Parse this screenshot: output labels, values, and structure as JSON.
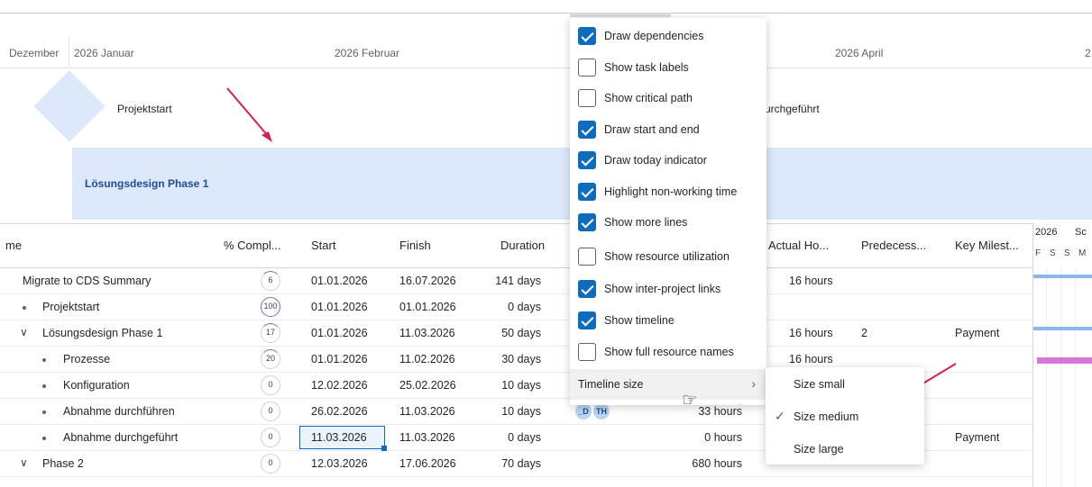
{
  "timeline": {
    "months": [
      "Dezember",
      "2026 Januar",
      "2026 Februar",
      "2026 April",
      "2"
    ],
    "milestone1": "Projektstart",
    "milestone2_partial": "urchgeführt",
    "phase": "Lösungsdesign Phase 1"
  },
  "grid": {
    "headers": {
      "name": "me",
      "pct": "% Compl...",
      "start": "Start",
      "finish": "Finish",
      "duration": "Duration",
      "actual": "Actual Ho...",
      "pred": "Predecess...",
      "key": "Key Milest..."
    },
    "rows": [
      {
        "name": "Migrate to CDS Summary",
        "pct": "6",
        "start": "01.01.2026",
        "finish": "16.07.2026",
        "duration": "141 days",
        "actual": "16 hours",
        "pred": "",
        "key": ""
      },
      {
        "name": "Projektstart",
        "pct": "100",
        "start": "01.01.2026",
        "finish": "01.01.2026",
        "duration": "0 days",
        "actual": "",
        "pred": "",
        "key": ""
      },
      {
        "name": "Lösungsdesign Phase 1",
        "pct": "17",
        "start": "01.01.2026",
        "finish": "11.03.2026",
        "duration": "50 days",
        "actual": "16 hours",
        "pred": "2",
        "key": "Payment"
      },
      {
        "name": "Prozesse",
        "pct": "20",
        "start": "01.01.2026",
        "finish": "11.02.2026",
        "duration": "30 days",
        "actual": "16 hours",
        "pred": "",
        "key": ""
      },
      {
        "name": "Konfiguration",
        "pct": "0",
        "start": "12.02.2026",
        "finish": "25.02.2026",
        "duration": "10 days",
        "actual": "",
        "pred": "",
        "key": ""
      },
      {
        "name": "Abnahme durchführen",
        "pct": "0",
        "start": "26.02.2026",
        "finish": "11.03.2026",
        "duration": "10 days",
        "actual": "33 hours",
        "pred": "",
        "key": ""
      },
      {
        "name": "Abnahme durchgeführt",
        "pct": "0",
        "start": "11.03.2026",
        "finish": "11.03.2026",
        "duration": "0 days",
        "actual": "0 hours",
        "pred": "",
        "key": "Payment"
      },
      {
        "name": "Phase 2",
        "pct": "0",
        "start": "12.03.2026",
        "finish": "17.06.2026",
        "duration": "70 days",
        "actual": "680 hours",
        "pred": "",
        "key": ""
      }
    ],
    "avatars": [
      "_D",
      "TH"
    ]
  },
  "mini": {
    "year": "2026",
    "year2": "Sc",
    "days": [
      "F",
      "S",
      "S",
      "M"
    ]
  },
  "menu": {
    "items": [
      {
        "label": "Draw dependencies",
        "checked": true
      },
      {
        "label": "Show task labels",
        "checked": false
      },
      {
        "label": "Show critical path",
        "checked": false
      },
      {
        "label": "Draw start and end",
        "checked": true
      },
      {
        "label": "Draw today indicator",
        "checked": true
      },
      {
        "label": "Highlight non-working time",
        "checked": true
      },
      {
        "label": "Show more lines",
        "checked": true
      },
      {
        "label": "Show resource utilization",
        "checked": false
      },
      {
        "label": "Show inter-project links",
        "checked": true
      },
      {
        "label": "Show timeline",
        "checked": true
      },
      {
        "label": "Show full resource names",
        "checked": false
      }
    ],
    "timeline_size": "Timeline size",
    "sub": [
      {
        "label": "Size small",
        "checked": false
      },
      {
        "label": "Size medium",
        "checked": true
      },
      {
        "label": "Size large",
        "checked": false
      }
    ]
  },
  "colors": {
    "accent": "#0f6cbd",
    "annotation": "#d1234d",
    "progress": "#8661c5"
  }
}
